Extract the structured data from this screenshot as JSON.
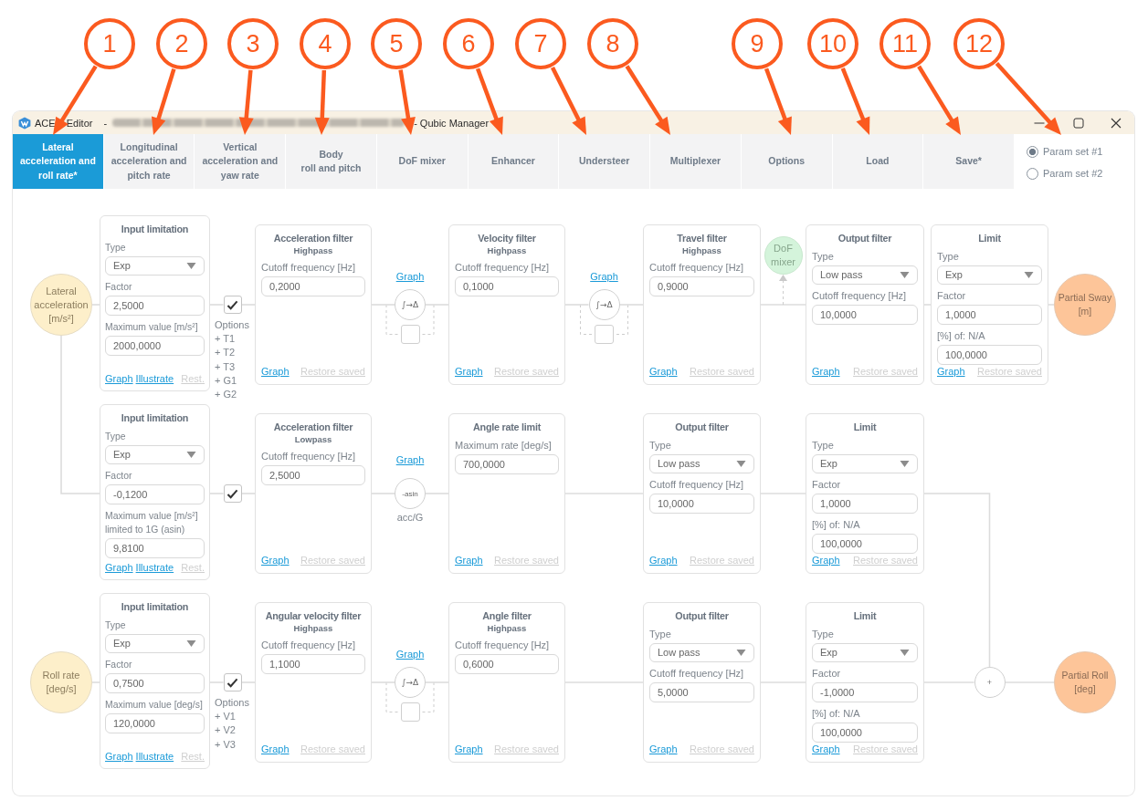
{
  "callouts": [
    {
      "number": "1"
    },
    {
      "number": "2"
    },
    {
      "number": "3"
    },
    {
      "number": "4"
    },
    {
      "number": "5"
    },
    {
      "number": "6"
    },
    {
      "number": "7"
    },
    {
      "number": "8"
    },
    {
      "number": "9"
    },
    {
      "number": "10"
    },
    {
      "number": "11"
    },
    {
      "number": "12"
    }
  ],
  "window": {
    "title": "ACE Editor -",
    "title_end": "- Qubic Manager"
  },
  "tabs": [
    {
      "label": "Lateral\nacceleration and\nroll rate*",
      "selected": true
    },
    {
      "label": "Longitudinal\nacceleration and\npitch rate",
      "selected": false
    },
    {
      "label": "Vertical\nacceleration and\nyaw rate",
      "selected": false
    },
    {
      "label": "Body\nroll and pitch",
      "selected": false
    },
    {
      "label": "DoF mixer",
      "selected": false
    },
    {
      "label": "Enhancer",
      "selected": false
    },
    {
      "label": "Understeer",
      "selected": false
    },
    {
      "label": "Multiplexer",
      "selected": false
    },
    {
      "label": "Options",
      "selected": false
    },
    {
      "label": "Load",
      "selected": false
    },
    {
      "label": "Save*",
      "selected": false
    }
  ],
  "param_sets": [
    {
      "label": "Param set #1",
      "selected": true
    },
    {
      "label": "Param set #2",
      "selected": false
    }
  ],
  "rows": [
    {
      "stages": [
        {
          "kind": "source",
          "label": "Lateral acceleration [m/s²]"
        },
        {
          "kind": "limiter",
          "title": "Input limitation",
          "fields": [
            {
              "kind": "select",
              "label": "Type",
              "value": "Exp"
            },
            {
              "kind": "number",
              "label": "Factor",
              "value": "2,5000"
            },
            {
              "kind": "number",
              "label": "Maximum value [m/s²]",
              "value": "2000,0000"
            }
          ],
          "actions": [
            {
              "label": "Graph",
              "disabled": false
            },
            {
              "label": "Illustrate",
              "disabled": false
            },
            {
              "label": "Rest.",
              "disabled": true
            }
          ]
        },
        {
          "kind": "enable",
          "checked": true,
          "options_title": "Options",
          "options": [
            "+ T1",
            "+ T2",
            "+ T3",
            "+ G1",
            "+ G2"
          ]
        },
        {
          "kind": "filter",
          "title": "Acceleration filter",
          "subtitle": "Highpass",
          "fields": [
            {
              "kind": "number",
              "label": "Cutoff frequency [Hz]",
              "value": "0,2000"
            }
          ],
          "actions": [
            {
              "label": "Graph",
              "disabled": false
            },
            {
              "label": "Restore saved",
              "disabled": true
            }
          ]
        },
        {
          "kind": "integrator",
          "link": "Graph",
          "symbol": "∫→Δ",
          "checked": false
        },
        {
          "kind": "filter",
          "title": "Velocity filter",
          "subtitle": "Highpass",
          "fields": [
            {
              "kind": "number",
              "label": "Cutoff frequency [Hz]",
              "value": "0,1000"
            }
          ],
          "actions": [
            {
              "label": "Graph",
              "disabled": false
            },
            {
              "label": "Restore saved",
              "disabled": true
            }
          ]
        },
        {
          "kind": "integrator",
          "link": "Graph",
          "symbol": "∫→Δ",
          "checked": false
        },
        {
          "kind": "filter",
          "title": "Travel filter",
          "subtitle": "Highpass",
          "fields": [
            {
              "kind": "number",
              "label": "Cutoff frequency [Hz]",
              "value": "0,9000"
            }
          ],
          "actions": [
            {
              "label": "Graph",
              "disabled": false
            },
            {
              "label": "Restore saved",
              "disabled": true
            }
          ]
        },
        {
          "kind": "mixer",
          "label": "DoF mixer"
        },
        {
          "kind": "filter",
          "title": "Output filter",
          "fields": [
            {
              "kind": "select",
              "label": "Type",
              "value": "Low pass"
            },
            {
              "kind": "number",
              "label": "Cutoff frequency [Hz]",
              "value": "10,0000"
            }
          ],
          "actions": [
            {
              "label": "Graph",
              "disabled": false
            },
            {
              "label": "Restore saved",
              "disabled": true
            }
          ]
        },
        {
          "kind": "filter",
          "title": "Limit",
          "fields": [
            {
              "kind": "select",
              "label": "Type",
              "value": "Exp"
            },
            {
              "kind": "number",
              "label": "Factor",
              "value": "1,0000"
            },
            {
              "kind": "number",
              "label": "[%] of: N/A",
              "value": "100,0000"
            }
          ],
          "actions": [
            {
              "label": "Graph",
              "disabled": false
            },
            {
              "label": "Restore saved",
              "disabled": true
            }
          ]
        },
        {
          "kind": "sink",
          "label": "Partial Sway [m]"
        }
      ]
    },
    {
      "stages": [
        {
          "kind": "limiter",
          "title": "Input limitation",
          "fields": [
            {
              "kind": "select",
              "label": "Type",
              "value": "Exp"
            },
            {
              "kind": "number",
              "label": "Factor",
              "value": "-0,1200"
            },
            {
              "kind": "number",
              "label": "Maximum value [m/s²] limited to 1G (asin)",
              "value": "9,8100"
            }
          ],
          "actions": [
            {
              "label": "Graph",
              "disabled": false
            },
            {
              "label": "Illustrate",
              "disabled": false
            },
            {
              "label": "Rest.",
              "disabled": true
            }
          ]
        },
        {
          "kind": "enable",
          "checked": true
        },
        {
          "kind": "filter",
          "title": "Acceleration filter",
          "subtitle": "Lowpass",
          "fields": [
            {
              "kind": "number",
              "label": "Cutoff frequency [Hz]",
              "value": "2,5000"
            }
          ],
          "actions": [
            {
              "label": "Graph",
              "disabled": false
            },
            {
              "label": "Restore saved",
              "disabled": true
            }
          ]
        },
        {
          "kind": "transform",
          "link": "Graph",
          "symbol": "-asin",
          "caption": "acc/G"
        },
        {
          "kind": "filter",
          "title": "Angle rate limit",
          "fields": [
            {
              "kind": "number",
              "label": "Maximum rate [deg/s]",
              "value": "700,0000"
            }
          ],
          "actions": [
            {
              "label": "Graph",
              "disabled": false
            },
            {
              "label": "Restore saved",
              "disabled": true
            }
          ]
        },
        {
          "kind": "filter",
          "title": "Output filter",
          "fields": [
            {
              "kind": "select",
              "label": "Type",
              "value": "Low pass"
            },
            {
              "kind": "number",
              "label": "Cutoff frequency [Hz]",
              "value": "10,0000"
            }
          ],
          "actions": [
            {
              "label": "Graph",
              "disabled": false
            },
            {
              "label": "Restore saved",
              "disabled": true
            }
          ]
        },
        {
          "kind": "filter",
          "title": "Limit",
          "fields": [
            {
              "kind": "select",
              "label": "Type",
              "value": "Exp"
            },
            {
              "kind": "number",
              "label": "Factor",
              "value": "1,0000"
            },
            {
              "kind": "number",
              "label": "[%] of: N/A",
              "value": "100,0000"
            }
          ],
          "actions": [
            {
              "label": "Graph",
              "disabled": false
            },
            {
              "label": "Restore saved",
              "disabled": true
            }
          ]
        }
      ]
    },
    {
      "stages": [
        {
          "kind": "source",
          "label": "Roll rate [deg/s]"
        },
        {
          "kind": "limiter",
          "title": "Input limitation",
          "fields": [
            {
              "kind": "select",
              "label": "Type",
              "value": "Exp"
            },
            {
              "kind": "number",
              "label": "Factor",
              "value": "0,7500"
            },
            {
              "kind": "number",
              "label": "Maximum value [deg/s]",
              "value": "120,0000"
            }
          ],
          "actions": [
            {
              "label": "Graph",
              "disabled": false
            },
            {
              "label": "Illustrate",
              "disabled": false
            },
            {
              "label": "Rest.",
              "disabled": true
            }
          ]
        },
        {
          "kind": "enable",
          "checked": true,
          "options_title": "Options",
          "options": [
            "+ V1",
            "+ V2",
            "+ V3"
          ]
        },
        {
          "kind": "filter",
          "title": "Angular velocity filter",
          "subtitle": "Highpass",
          "fields": [
            {
              "kind": "number",
              "label": "Cutoff frequency [Hz]",
              "value": "1,1000"
            }
          ],
          "actions": [
            {
              "label": "Graph",
              "disabled": false
            },
            {
              "label": "Restore saved",
              "disabled": true
            }
          ]
        },
        {
          "kind": "integrator",
          "link": "Graph",
          "symbol": "∫→Δ",
          "checked": false
        },
        {
          "kind": "filter",
          "title": "Angle filter",
          "subtitle": "Highpass",
          "fields": [
            {
              "kind": "number",
              "label": "Cutoff frequency [Hz]",
              "value": "0,6000"
            }
          ],
          "actions": [
            {
              "label": "Graph",
              "disabled": false
            },
            {
              "label": "Restore saved",
              "disabled": true
            }
          ]
        },
        {
          "kind": "filter",
          "title": "Output filter",
          "fields": [
            {
              "kind": "select",
              "label": "Type",
              "value": "Low pass"
            },
            {
              "kind": "number",
              "label": "Cutoff frequency [Hz]",
              "value": "5,0000"
            }
          ],
          "actions": [
            {
              "label": "Graph",
              "disabled": false
            },
            {
              "label": "Restore saved",
              "disabled": true
            }
          ]
        },
        {
          "kind": "filter",
          "title": "Limit",
          "fields": [
            {
              "kind": "select",
              "label": "Type",
              "value": "Exp"
            },
            {
              "kind": "number",
              "label": "Factor",
              "value": "-1,0000"
            },
            {
              "kind": "number",
              "label": "[%] of: N/A",
              "value": "100,0000"
            }
          ],
          "actions": [
            {
              "label": "Graph",
              "disabled": false
            },
            {
              "label": "Restore saved",
              "disabled": true
            }
          ]
        },
        {
          "kind": "sum",
          "symbol": "+"
        },
        {
          "kind": "sink",
          "label": "Partial Roll [deg]"
        }
      ]
    }
  ]
}
